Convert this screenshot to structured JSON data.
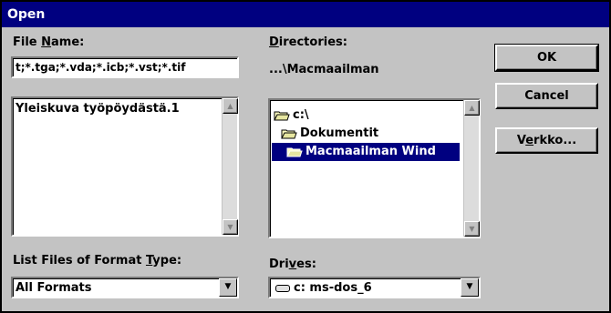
{
  "window": {
    "title": "Open"
  },
  "file_name": {
    "label_pre": "File ",
    "label_u": "N",
    "label_post": "ame:",
    "value": "t;*.tga;*.vda;*.icb;*.vst;*.tif"
  },
  "file_list": {
    "items": [
      "Yleiskuva työpöydästä.1"
    ]
  },
  "directories": {
    "label_u": "D",
    "label_post": "irectories:",
    "current_path": "...\\Macmaailman",
    "items": [
      {
        "label": "c:\\",
        "selected": false
      },
      {
        "label": "Dokumentit",
        "selected": false
      },
      {
        "label": "Macmaailman Wind",
        "selected": true
      }
    ]
  },
  "format_type": {
    "label_pre": "List Files of Format ",
    "label_u": "T",
    "label_post": "ype:",
    "value": "All Formats"
  },
  "drives": {
    "label_pre": "Dri",
    "label_u": "v",
    "label_post": "es:",
    "value": "c: ms-dos_6"
  },
  "buttons": {
    "ok": "OK",
    "cancel": "Cancel",
    "network_pre": "V",
    "network_u": "e",
    "network_post": "rkko..."
  },
  "colors": {
    "titlebar": "#000080",
    "selection": "#000080",
    "face": "#c3c3c3"
  }
}
